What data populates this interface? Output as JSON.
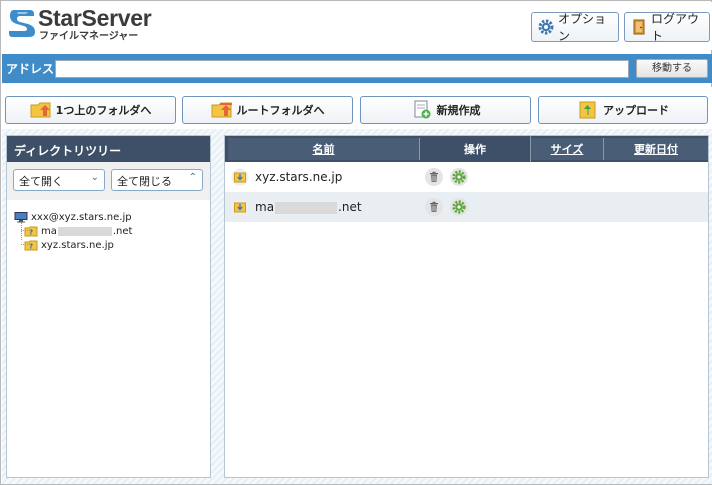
{
  "header": {
    "brand": "StarServer",
    "subtitle": "ファイルマネージャー",
    "options_label": "オプション",
    "logout_label": "ログアウト"
  },
  "address": {
    "label": "アドレス",
    "value": "",
    "go_label": "移動する"
  },
  "toolbar": {
    "up_label": "1つ上のフォルダへ",
    "root_label": "ルートフォルダへ",
    "new_label": "新規作成",
    "upload_label": "アップロード"
  },
  "directory": {
    "title": "ディレクトリツリー",
    "expand_label": "全て開く",
    "collapse_label": "全て閉じる",
    "root": "xxx@xyz.stars.ne.jp",
    "children": [
      {
        "prefix": "ma",
        "suffix": ".net"
      },
      {
        "prefix": "xyz.stars.ne.jp",
        "suffix": ""
      }
    ]
  },
  "files": {
    "columns": {
      "name": "名前",
      "ops": "操作",
      "size": "サイズ",
      "date": "更新日付"
    },
    "rows": [
      {
        "prefix": "xyz.stars.ne.jp",
        "suffix": ""
      },
      {
        "prefix": "ma",
        "suffix": ".net"
      }
    ]
  },
  "icons": {
    "logo": "starserver-logo",
    "options": "gear-icon",
    "logout": "door-icon",
    "up": "folder-up-icon",
    "root": "folder-root-icon",
    "new": "new-file-icon",
    "upload": "upload-icon",
    "delete": "trash-icon",
    "settings": "gear-icon"
  },
  "colors": {
    "address_bar": "#3f8cc8",
    "panel_header": "#3e5068",
    "button_border": "#6f94bd"
  }
}
